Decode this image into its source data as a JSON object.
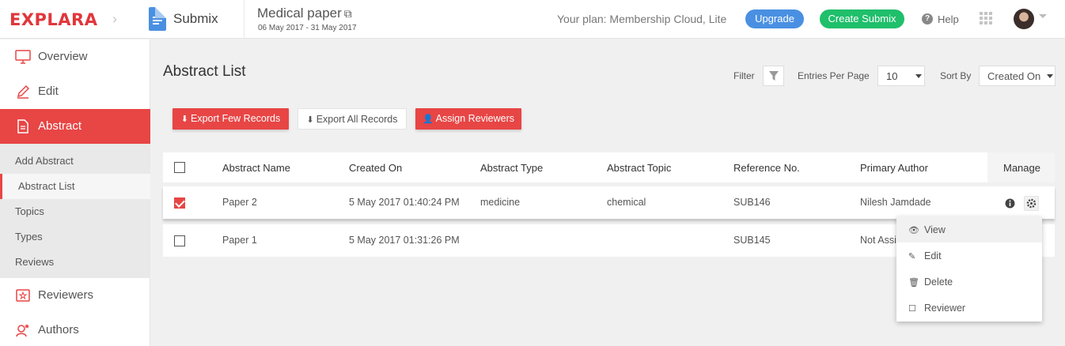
{
  "header": {
    "brand": "EXPLARA",
    "app_name": "Submix",
    "event_title": "Medical paper",
    "event_dates": "06 May 2017 - 31 May 2017",
    "plan_text": "Your plan: Membership Cloud, Lite",
    "upgrade_label": "Upgrade",
    "create_label": "Create Submix",
    "help_label": "Help"
  },
  "sidebar": {
    "items": [
      {
        "label": "Overview",
        "icon": "monitor-icon"
      },
      {
        "label": "Edit",
        "icon": "pencil-icon"
      },
      {
        "label": "Abstract",
        "icon": "document-icon"
      },
      {
        "label": "Reviewers",
        "icon": "reviewer-icon"
      },
      {
        "label": "Authors",
        "icon": "authors-icon"
      }
    ],
    "sub_items": [
      {
        "label": "Add Abstract"
      },
      {
        "label": "Abstract List"
      },
      {
        "label": "Topics"
      },
      {
        "label": "Types"
      },
      {
        "label": "Reviews"
      }
    ]
  },
  "main": {
    "title": "Abstract List",
    "filter_label": "Filter",
    "entries_label": "Entries Per Page",
    "entries_value": "10",
    "sort_label": "Sort By",
    "sort_value": "Created On",
    "buttons": {
      "export_few": "Export Few Records",
      "export_all": "Export All Records",
      "assign": "Assign Reviewers"
    }
  },
  "table": {
    "columns": [
      "Abstract Name",
      "Created On",
      "Abstract Type",
      "Abstract Topic",
      "Reference No.",
      "Primary Author",
      "Manage"
    ],
    "rows": [
      {
        "checked": true,
        "name": "Paper 2",
        "created": "5 May 2017 01:40:24 PM",
        "type": "medicine",
        "topic": "chemical",
        "ref": "SUB146",
        "author": "Nilesh Jamdade"
      },
      {
        "checked": false,
        "name": "Paper 1",
        "created": "5 May 2017 01:31:26 PM",
        "type": "",
        "topic": "",
        "ref": "SUB145",
        "author": "Not Assi"
      }
    ]
  },
  "dropdown": {
    "items": [
      {
        "label": "View",
        "icon": "eye-icon"
      },
      {
        "label": "Edit",
        "icon": "pencil-icon"
      },
      {
        "label": "Delete",
        "icon": "trash-icon"
      },
      {
        "label": "Reviewer",
        "icon": "note-icon"
      }
    ]
  },
  "colors": {
    "brand_red": "#e84545",
    "upgrade_blue": "#4a90e2",
    "create_green": "#1fbf6b"
  }
}
